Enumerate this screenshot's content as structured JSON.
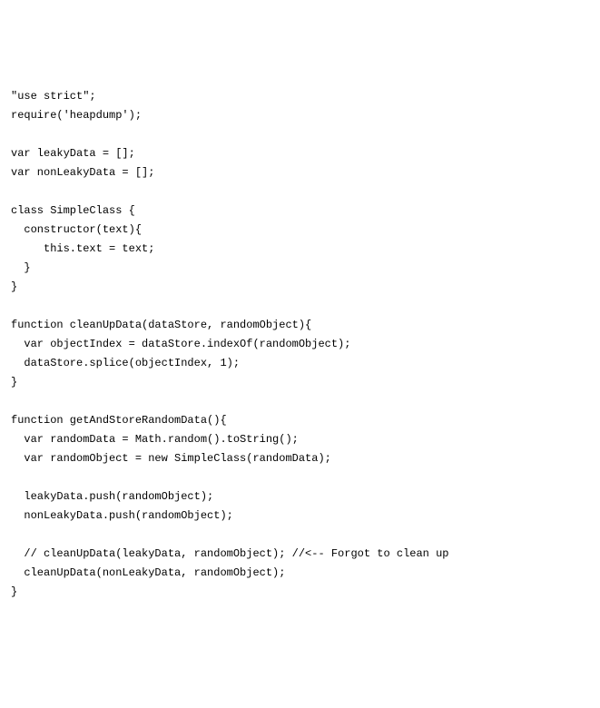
{
  "code": {
    "lines": [
      "\"use strict\";",
      "require('heapdump');",
      "",
      "var leakyData = [];",
      "var nonLeakyData = [];",
      "",
      "class SimpleClass {",
      "  constructor(text){",
      "     this.text = text;",
      "  }",
      "}",
      "",
      "function cleanUpData(dataStore, randomObject){",
      "  var objectIndex = dataStore.indexOf(randomObject);",
      "  dataStore.splice(objectIndex, 1);",
      "}",
      "",
      "function getAndStoreRandomData(){",
      "  var randomData = Math.random().toString();",
      "  var randomObject = new SimpleClass(randomData);",
      "",
      "  leakyData.push(randomObject);",
      "  nonLeakyData.push(randomObject);",
      "",
      "  // cleanUpData(leakyData, randomObject); //<-- Forgot to clean up",
      "  cleanUpData(nonLeakyData, randomObject);",
      "}"
    ]
  }
}
